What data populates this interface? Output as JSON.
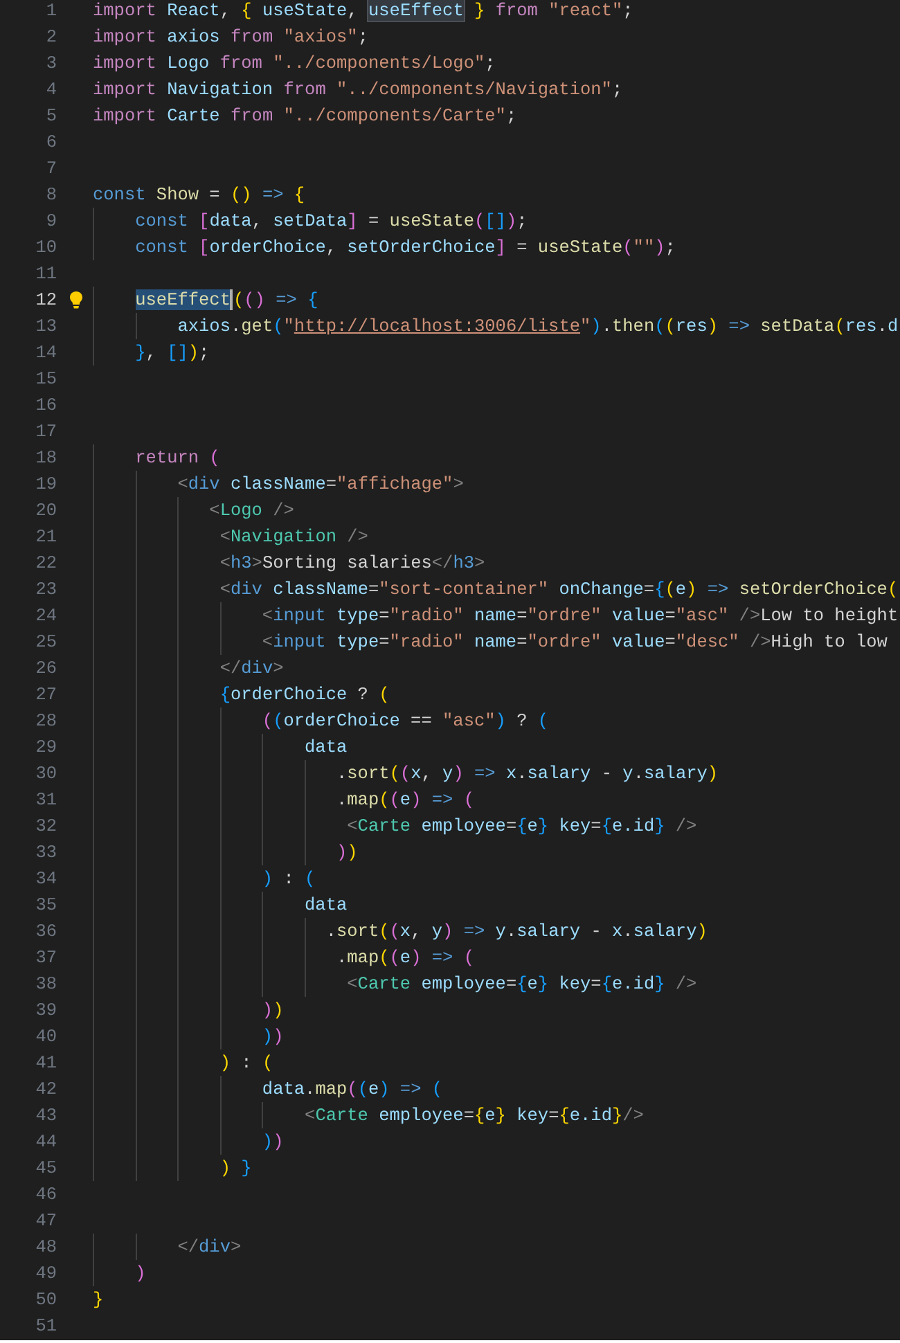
{
  "editor": {
    "lines": [
      {
        "number": "1",
        "current": false,
        "lightbulb": false,
        "tokens": [
          {
            "kind": "keyword",
            "text": "import"
          },
          {
            "kind": "variable",
            "text": " React"
          },
          {
            "kind": "plain",
            "text": ", "
          },
          {
            "kind": "bracket1",
            "text": "{"
          },
          {
            "kind": "variable",
            "text": " useState"
          },
          {
            "kind": "plain",
            "text": ", "
          },
          {
            "kind": "variable",
            "text": "useEffect",
            "occurrence": true
          },
          {
            "kind": "bracket1",
            "text": " }"
          },
          {
            "kind": "keyword",
            "text": " from"
          },
          {
            "kind": "string",
            "text": " \"react\""
          },
          {
            "kind": "plain",
            "text": ";"
          }
        ]
      },
      {
        "number": "2",
        "current": false,
        "lightbulb": false,
        "tokens": [
          {
            "kind": "keyword",
            "text": "import"
          },
          {
            "kind": "variable",
            "text": " axios"
          },
          {
            "kind": "keyword",
            "text": " from"
          },
          {
            "kind": "string",
            "text": " \"axios\""
          },
          {
            "kind": "plain",
            "text": ";"
          }
        ]
      },
      {
        "number": "3",
        "current": false,
        "lightbulb": false,
        "tokens": [
          {
            "kind": "keyword",
            "text": "import"
          },
          {
            "kind": "variable",
            "text": " Logo"
          },
          {
            "kind": "keyword",
            "text": " from"
          },
          {
            "kind": "string",
            "text": " \"../components/Logo\""
          },
          {
            "kind": "plain",
            "text": ";"
          }
        ]
      },
      {
        "number": "4",
        "current": false,
        "lightbulb": false,
        "tokens": [
          {
            "kind": "keyword",
            "text": "import"
          },
          {
            "kind": "variable",
            "text": " Navigation"
          },
          {
            "kind": "keyword",
            "text": " from"
          },
          {
            "kind": "string",
            "text": " \"../components/Navigation\""
          },
          {
            "kind": "plain",
            "text": ";"
          }
        ]
      },
      {
        "number": "5",
        "current": false,
        "lightbulb": false,
        "tokens": [
          {
            "kind": "keyword",
            "text": "import"
          },
          {
            "kind": "variable",
            "text": " Carte"
          },
          {
            "kind": "keyword",
            "text": " from"
          },
          {
            "kind": "string",
            "text": " \"../components/Carte\""
          },
          {
            "kind": "plain",
            "text": ";"
          }
        ]
      },
      {
        "number": "6",
        "current": false,
        "lightbulb": false
      },
      {
        "number": "7",
        "current": false,
        "lightbulb": false
      },
      {
        "number": "8",
        "current": false,
        "lightbulb": false,
        "tokens": [
          {
            "kind": "storage",
            "text": "const"
          },
          {
            "kind": "function",
            "text": " Show"
          },
          {
            "kind": "plain",
            "text": " = "
          },
          {
            "kind": "bracket1",
            "text": "()"
          },
          {
            "kind": "storage",
            "text": " =>"
          },
          {
            "kind": "bracket1",
            "text": " {"
          }
        ]
      },
      {
        "number": "9",
        "current": false,
        "lightbulb": false,
        "tokens": [
          {
            "kind": "storage",
            "text": "    const"
          },
          {
            "kind": "bracket2",
            "text": " ["
          },
          {
            "kind": "variable",
            "text": "data"
          },
          {
            "kind": "plain",
            "text": ", "
          },
          {
            "kind": "variable",
            "text": "setData"
          },
          {
            "kind": "bracket2",
            "text": "]"
          },
          {
            "kind": "plain",
            "text": " = "
          },
          {
            "kind": "function",
            "text": "useState"
          },
          {
            "kind": "bracket2",
            "text": "("
          },
          {
            "kind": "bracket3",
            "text": "[]"
          },
          {
            "kind": "bracket2",
            "text": ")"
          },
          {
            "kind": "plain",
            "text": ";"
          }
        ]
      },
      {
        "number": "10",
        "current": false,
        "lightbulb": false,
        "tokens": [
          {
            "kind": "storage",
            "text": "    const"
          },
          {
            "kind": "bracket2",
            "text": " ["
          },
          {
            "kind": "variable",
            "text": "orderChoice"
          },
          {
            "kind": "plain",
            "text": ", "
          },
          {
            "kind": "variable",
            "text": "setOrderChoice"
          },
          {
            "kind": "bracket2",
            "text": "]"
          },
          {
            "kind": "plain",
            "text": " = "
          },
          {
            "kind": "function",
            "text": "useState"
          },
          {
            "kind": "bracket2",
            "text": "("
          },
          {
            "kind": "string",
            "text": "\"\""
          },
          {
            "kind": "bracket2",
            "text": ")"
          },
          {
            "kind": "plain",
            "text": ";"
          }
        ]
      },
      {
        "number": "11",
        "current": false,
        "lightbulb": false
      },
      {
        "number": "12",
        "current": true,
        "lightbulb": true,
        "tokens": [
          {
            "kind": "function",
            "text": "    useEffect",
            "selected": true
          },
          {
            "kind": "bracket1",
            "text": "("
          },
          {
            "kind": "bracket2",
            "text": "()"
          },
          {
            "kind": "storage",
            "text": " =>"
          },
          {
            "kind": "bracket3",
            "text": " {"
          }
        ]
      },
      {
        "number": "13",
        "current": false,
        "lightbulb": false,
        "tokens": [
          {
            "kind": "variable",
            "text": "        axios"
          },
          {
            "kind": "plain",
            "text": "."
          },
          {
            "kind": "function",
            "text": "get"
          },
          {
            "kind": "bracket3",
            "text": "("
          },
          {
            "kind": "string",
            "text": "\""
          },
          {
            "kind": "link",
            "text": "http://localhost:3006/liste"
          },
          {
            "kind": "string",
            "text": "\""
          },
          {
            "kind": "bracket3",
            "text": ")"
          },
          {
            "kind": "plain",
            "text": "."
          },
          {
            "kind": "function",
            "text": "then"
          },
          {
            "kind": "bracket3",
            "text": "("
          },
          {
            "kind": "bracket1",
            "text": "("
          },
          {
            "kind": "variable",
            "text": "res"
          },
          {
            "kind": "bracket1",
            "text": ")"
          },
          {
            "kind": "storage",
            "text": " =>"
          },
          {
            "kind": "function",
            "text": " setData"
          },
          {
            "kind": "bracket1",
            "text": "("
          },
          {
            "kind": "variable",
            "text": "res"
          },
          {
            "kind": "plain",
            "text": "."
          },
          {
            "kind": "variable",
            "text": "d"
          }
        ]
      },
      {
        "number": "14",
        "current": false,
        "lightbulb": false,
        "tokens": [
          {
            "kind": "bracket3",
            "text": "    }"
          },
          {
            "kind": "plain",
            "text": ", "
          },
          {
            "kind": "bracket3",
            "text": "[]"
          },
          {
            "kind": "bracket1",
            "text": ")"
          },
          {
            "kind": "plain",
            "text": ";"
          }
        ]
      },
      {
        "number": "15",
        "current": false,
        "lightbulb": false
      },
      {
        "number": "16",
        "current": false,
        "lightbulb": false
      },
      {
        "number": "17",
        "current": false,
        "lightbulb": false
      },
      {
        "number": "18",
        "current": false,
        "lightbulb": false,
        "tokens": [
          {
            "kind": "keyword",
            "text": "    return"
          },
          {
            "kind": "bracket2",
            "text": " ("
          }
        ]
      },
      {
        "number": "19",
        "current": false,
        "lightbulb": false,
        "tokens": [
          {
            "kind": "tag",
            "text": "        <"
          },
          {
            "kind": "storage",
            "text": "div"
          },
          {
            "kind": "variable",
            "text": " className"
          },
          {
            "kind": "plain",
            "text": "="
          },
          {
            "kind": "string",
            "text": "\"affichage\""
          },
          {
            "kind": "tag",
            "text": ">"
          }
        ]
      },
      {
        "number": "20",
        "current": false,
        "lightbulb": false,
        "tokens": [
          {
            "kind": "tag",
            "text": "           <"
          },
          {
            "kind": "component",
            "text": "Logo"
          },
          {
            "kind": "tag",
            "text": " />"
          }
        ]
      },
      {
        "number": "21",
        "current": false,
        "lightbulb": false,
        "tokens": [
          {
            "kind": "tag",
            "text": "            <"
          },
          {
            "kind": "component",
            "text": "Navigation"
          },
          {
            "kind": "tag",
            "text": " />"
          }
        ]
      },
      {
        "number": "22",
        "current": false,
        "lightbulb": false,
        "tokens": [
          {
            "kind": "tag",
            "text": "            <"
          },
          {
            "kind": "storage",
            "text": "h3"
          },
          {
            "kind": "tag",
            "text": ">"
          },
          {
            "kind": "plain",
            "text": "Sorting salaries"
          },
          {
            "kind": "tag",
            "text": "</"
          },
          {
            "kind": "storage",
            "text": "h3"
          },
          {
            "kind": "tag",
            "text": ">"
          }
        ]
      },
      {
        "number": "23",
        "current": false,
        "lightbulb": false,
        "tokens": [
          {
            "kind": "tag",
            "text": "            <"
          },
          {
            "kind": "storage",
            "text": "div"
          },
          {
            "kind": "variable",
            "text": " className"
          },
          {
            "kind": "plain",
            "text": "="
          },
          {
            "kind": "string",
            "text": "\"sort-container\""
          },
          {
            "kind": "variable",
            "text": " onChange"
          },
          {
            "kind": "plain",
            "text": "="
          },
          {
            "kind": "bracket3",
            "text": "{"
          },
          {
            "kind": "bracket1",
            "text": "("
          },
          {
            "kind": "variable",
            "text": "e"
          },
          {
            "kind": "bracket1",
            "text": ")"
          },
          {
            "kind": "storage",
            "text": " =>"
          },
          {
            "kind": "function",
            "text": " setOrderChoice"
          },
          {
            "kind": "bracket1",
            "text": "("
          }
        ]
      },
      {
        "number": "24",
        "current": false,
        "lightbulb": false,
        "tokens": [
          {
            "kind": "tag",
            "text": "                <"
          },
          {
            "kind": "storage",
            "text": "input"
          },
          {
            "kind": "variable",
            "text": " type"
          },
          {
            "kind": "plain",
            "text": "="
          },
          {
            "kind": "string",
            "text": "\"radio\""
          },
          {
            "kind": "variable",
            "text": " name"
          },
          {
            "kind": "plain",
            "text": "="
          },
          {
            "kind": "string",
            "text": "\"ordre\""
          },
          {
            "kind": "variable",
            "text": " value"
          },
          {
            "kind": "plain",
            "text": "="
          },
          {
            "kind": "string",
            "text": "\"asc\""
          },
          {
            "kind": "tag",
            "text": " />"
          },
          {
            "kind": "plain",
            "text": "Low to height"
          }
        ]
      },
      {
        "number": "25",
        "current": false,
        "lightbulb": false,
        "tokens": [
          {
            "kind": "tag",
            "text": "                <"
          },
          {
            "kind": "storage",
            "text": "input"
          },
          {
            "kind": "variable",
            "text": " type"
          },
          {
            "kind": "plain",
            "text": "="
          },
          {
            "kind": "string",
            "text": "\"radio\""
          },
          {
            "kind": "variable",
            "text": " name"
          },
          {
            "kind": "plain",
            "text": "="
          },
          {
            "kind": "string",
            "text": "\"ordre\""
          },
          {
            "kind": "variable",
            "text": " value"
          },
          {
            "kind": "plain",
            "text": "="
          },
          {
            "kind": "string",
            "text": "\"desc\""
          },
          {
            "kind": "tag",
            "text": " />"
          },
          {
            "kind": "plain",
            "text": "High to low"
          }
        ]
      },
      {
        "number": "26",
        "current": false,
        "lightbulb": false,
        "tokens": [
          {
            "kind": "tag",
            "text": "            </"
          },
          {
            "kind": "storage",
            "text": "div"
          },
          {
            "kind": "tag",
            "text": ">"
          }
        ]
      },
      {
        "number": "27",
        "current": false,
        "lightbulb": false,
        "tokens": [
          {
            "kind": "bracket3",
            "text": "            {"
          },
          {
            "kind": "variable",
            "text": "orderChoice"
          },
          {
            "kind": "plain",
            "text": " ?"
          },
          {
            "kind": "bracket1",
            "text": " ("
          }
        ]
      },
      {
        "number": "28",
        "current": false,
        "lightbulb": false,
        "tokens": [
          {
            "kind": "bracket2",
            "text": "                ("
          },
          {
            "kind": "bracket3",
            "text": "("
          },
          {
            "kind": "variable",
            "text": "orderChoice"
          },
          {
            "kind": "plain",
            "text": " == "
          },
          {
            "kind": "string",
            "text": "\"asc\""
          },
          {
            "kind": "bracket3",
            "text": ")"
          },
          {
            "kind": "plain",
            "text": " ? "
          },
          {
            "kind": "bracket3",
            "text": "("
          }
        ]
      },
      {
        "number": "29",
        "current": false,
        "lightbulb": false,
        "tokens": [
          {
            "kind": "variable",
            "text": "                    data"
          }
        ]
      },
      {
        "number": "30",
        "current": false,
        "lightbulb": false,
        "tokens": [
          {
            "kind": "plain",
            "text": "                       ."
          },
          {
            "kind": "function",
            "text": "sort"
          },
          {
            "kind": "bracket1",
            "text": "("
          },
          {
            "kind": "bracket2",
            "text": "("
          },
          {
            "kind": "variable",
            "text": "x"
          },
          {
            "kind": "plain",
            "text": ", "
          },
          {
            "kind": "variable",
            "text": "y"
          },
          {
            "kind": "bracket2",
            "text": ")"
          },
          {
            "kind": "storage",
            "text": " =>"
          },
          {
            "kind": "variable",
            "text": " x"
          },
          {
            "kind": "plain",
            "text": "."
          },
          {
            "kind": "variable",
            "text": "salary"
          },
          {
            "kind": "plain",
            "text": " - "
          },
          {
            "kind": "variable",
            "text": "y"
          },
          {
            "kind": "plain",
            "text": "."
          },
          {
            "kind": "variable",
            "text": "salary"
          },
          {
            "kind": "bracket1",
            "text": ")"
          }
        ]
      },
      {
        "number": "31",
        "current": false,
        "lightbulb": false,
        "tokens": [
          {
            "kind": "plain",
            "text": "                       ."
          },
          {
            "kind": "function",
            "text": "map"
          },
          {
            "kind": "bracket1",
            "text": "("
          },
          {
            "kind": "bracket2",
            "text": "("
          },
          {
            "kind": "variable",
            "text": "e"
          },
          {
            "kind": "bracket2",
            "text": ")"
          },
          {
            "kind": "storage",
            "text": " =>"
          },
          {
            "kind": "bracket2",
            "text": " ("
          }
        ]
      },
      {
        "number": "32",
        "current": false,
        "lightbulb": false,
        "tokens": [
          {
            "kind": "tag",
            "text": "                        <"
          },
          {
            "kind": "component",
            "text": "Carte"
          },
          {
            "kind": "variable",
            "text": " employee"
          },
          {
            "kind": "plain",
            "text": "="
          },
          {
            "kind": "bracket3",
            "text": "{"
          },
          {
            "kind": "variable",
            "text": "e"
          },
          {
            "kind": "bracket3",
            "text": "}"
          },
          {
            "kind": "variable",
            "text": " key"
          },
          {
            "kind": "plain",
            "text": "="
          },
          {
            "kind": "bracket3",
            "text": "{"
          },
          {
            "kind": "variable",
            "text": "e.id"
          },
          {
            "kind": "bracket3",
            "text": "}"
          },
          {
            "kind": "tag",
            "text": " />"
          }
        ]
      },
      {
        "number": "33",
        "current": false,
        "lightbulb": false,
        "tokens": [
          {
            "kind": "bracket2",
            "text": "                       )"
          },
          {
            "kind": "bracket1",
            "text": ")"
          }
        ]
      },
      {
        "number": "34",
        "current": false,
        "lightbulb": false,
        "tokens": [
          {
            "kind": "bracket3",
            "text": "                )"
          },
          {
            "kind": "plain",
            "text": " : "
          },
          {
            "kind": "bracket3",
            "text": "("
          }
        ]
      },
      {
        "number": "35",
        "current": false,
        "lightbulb": false,
        "tokens": [
          {
            "kind": "variable",
            "text": "                    data"
          }
        ]
      },
      {
        "number": "36",
        "current": false,
        "lightbulb": false,
        "tokens": [
          {
            "kind": "plain",
            "text": "                      ."
          },
          {
            "kind": "function",
            "text": "sort"
          },
          {
            "kind": "bracket1",
            "text": "("
          },
          {
            "kind": "bracket2",
            "text": "("
          },
          {
            "kind": "variable",
            "text": "x"
          },
          {
            "kind": "plain",
            "text": ", "
          },
          {
            "kind": "variable",
            "text": "y"
          },
          {
            "kind": "bracket2",
            "text": ")"
          },
          {
            "kind": "storage",
            "text": " =>"
          },
          {
            "kind": "variable",
            "text": " y"
          },
          {
            "kind": "plain",
            "text": "."
          },
          {
            "kind": "variable",
            "text": "salary"
          },
          {
            "kind": "plain",
            "text": " - "
          },
          {
            "kind": "variable",
            "text": "x"
          },
          {
            "kind": "plain",
            "text": "."
          },
          {
            "kind": "variable",
            "text": "salary"
          },
          {
            "kind": "bracket1",
            "text": ")"
          }
        ]
      },
      {
        "number": "37",
        "current": false,
        "lightbulb": false,
        "tokens": [
          {
            "kind": "plain",
            "text": "                       ."
          },
          {
            "kind": "function",
            "text": "map"
          },
          {
            "kind": "bracket1",
            "text": "("
          },
          {
            "kind": "bracket2",
            "text": "("
          },
          {
            "kind": "variable",
            "text": "e"
          },
          {
            "kind": "bracket2",
            "text": ")"
          },
          {
            "kind": "storage",
            "text": " =>"
          },
          {
            "kind": "bracket2",
            "text": " ("
          }
        ]
      },
      {
        "number": "38",
        "current": false,
        "lightbulb": false,
        "tokens": [
          {
            "kind": "tag",
            "text": "                        <"
          },
          {
            "kind": "component",
            "text": "Carte"
          },
          {
            "kind": "variable",
            "text": " employee"
          },
          {
            "kind": "plain",
            "text": "="
          },
          {
            "kind": "bracket3",
            "text": "{"
          },
          {
            "kind": "variable",
            "text": "e"
          },
          {
            "kind": "bracket3",
            "text": "}"
          },
          {
            "kind": "variable",
            "text": " key"
          },
          {
            "kind": "plain",
            "text": "="
          },
          {
            "kind": "bracket3",
            "text": "{"
          },
          {
            "kind": "variable",
            "text": "e.id"
          },
          {
            "kind": "bracket3",
            "text": "}"
          },
          {
            "kind": "tag",
            "text": " />"
          }
        ]
      },
      {
        "number": "39",
        "current": false,
        "lightbulb": false,
        "tokens": [
          {
            "kind": "bracket2",
            "text": "                )"
          },
          {
            "kind": "bracket1",
            "text": ")"
          }
        ]
      },
      {
        "number": "40",
        "current": false,
        "lightbulb": false,
        "tokens": [
          {
            "kind": "bracket3",
            "text": "                )"
          },
          {
            "kind": "bracket2",
            "text": ")"
          }
        ]
      },
      {
        "number": "41",
        "current": false,
        "lightbulb": false,
        "tokens": [
          {
            "kind": "bracket1",
            "text": "            )"
          },
          {
            "kind": "plain",
            "text": " : "
          },
          {
            "kind": "bracket1",
            "text": "("
          }
        ]
      },
      {
        "number": "42",
        "current": false,
        "lightbulb": false,
        "tokens": [
          {
            "kind": "variable",
            "text": "                data"
          },
          {
            "kind": "plain",
            "text": "."
          },
          {
            "kind": "function",
            "text": "map"
          },
          {
            "kind": "bracket2",
            "text": "("
          },
          {
            "kind": "bracket3",
            "text": "("
          },
          {
            "kind": "variable",
            "text": "e"
          },
          {
            "kind": "bracket3",
            "text": ")"
          },
          {
            "kind": "storage",
            "text": " =>"
          },
          {
            "kind": "bracket3",
            "text": " ("
          }
        ]
      },
      {
        "number": "43",
        "current": false,
        "lightbulb": false,
        "tokens": [
          {
            "kind": "tag",
            "text": "                    <"
          },
          {
            "kind": "component",
            "text": "Carte"
          },
          {
            "kind": "variable",
            "text": " employee"
          },
          {
            "kind": "plain",
            "text": "="
          },
          {
            "kind": "bracket1",
            "text": "{"
          },
          {
            "kind": "variable",
            "text": "e"
          },
          {
            "kind": "bracket1",
            "text": "}"
          },
          {
            "kind": "variable",
            "text": " key"
          },
          {
            "kind": "plain",
            "text": "="
          },
          {
            "kind": "bracket1",
            "text": "{"
          },
          {
            "kind": "variable",
            "text": "e.id"
          },
          {
            "kind": "bracket1",
            "text": "}"
          },
          {
            "kind": "tag",
            "text": "/>"
          }
        ]
      },
      {
        "number": "44",
        "current": false,
        "lightbulb": false,
        "tokens": [
          {
            "kind": "bracket3",
            "text": "                )"
          },
          {
            "kind": "bracket2",
            "text": ")"
          }
        ]
      },
      {
        "number": "45",
        "current": false,
        "lightbulb": false,
        "tokens": [
          {
            "kind": "bracket1",
            "text": "            )"
          },
          {
            "kind": "bracket3",
            "text": " }"
          }
        ]
      },
      {
        "number": "46",
        "current": false,
        "lightbulb": false
      },
      {
        "number": "47",
        "current": false,
        "lightbulb": false
      },
      {
        "number": "48",
        "current": false,
        "lightbulb": false,
        "tokens": [
          {
            "kind": "tag",
            "text": "        </"
          },
          {
            "kind": "storage",
            "text": "div"
          },
          {
            "kind": "tag",
            "text": ">"
          }
        ]
      },
      {
        "number": "49",
        "current": false,
        "lightbulb": false,
        "tokens": [
          {
            "kind": "bracket2",
            "text": "    )"
          }
        ]
      },
      {
        "number": "50",
        "current": false,
        "lightbulb": false,
        "tokens": [
          {
            "kind": "bracket1",
            "text": "}"
          }
        ]
      },
      {
        "number": "51",
        "current": false,
        "lightbulb": false
      }
    ]
  }
}
